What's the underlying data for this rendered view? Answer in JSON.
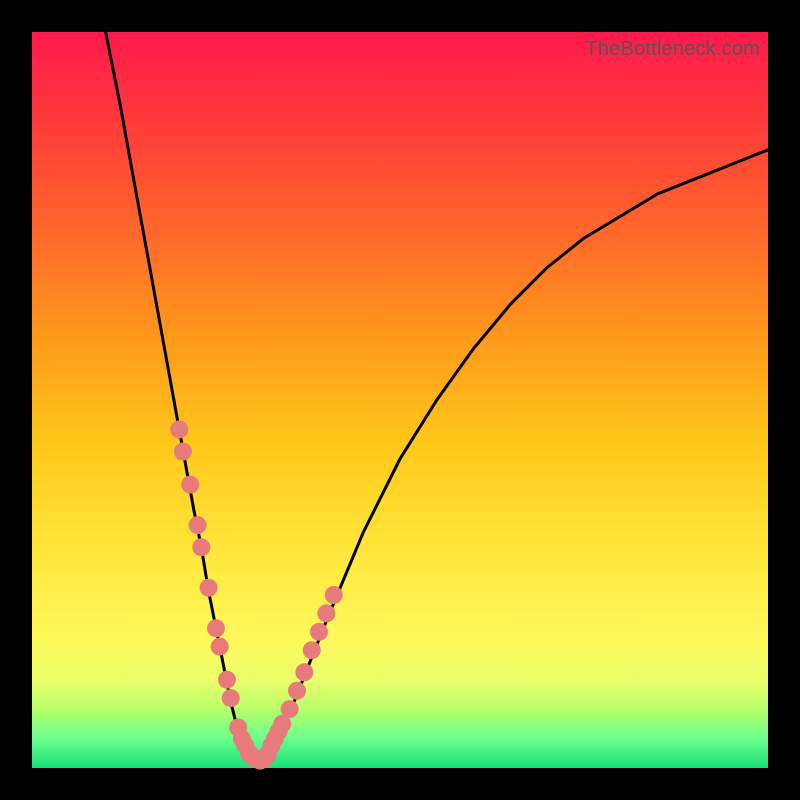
{
  "watermark": "TheBottleneck.com",
  "colors": {
    "curve_stroke": "#000000",
    "dot_fill": "#e77b7b",
    "dot_fill_dark": "#d86a6a",
    "frame": "#000000"
  },
  "chart_data": {
    "type": "line",
    "title": "",
    "xlabel": "",
    "ylabel": "",
    "xlim": [
      0,
      100
    ],
    "ylim": [
      0,
      100
    ],
    "grid": false,
    "legend": false,
    "series": [
      {
        "name": "bottleneck-curve",
        "x": [
          10,
          12,
          14,
          16,
          18,
          20,
          22,
          23,
          24,
          25,
          26,
          27,
          28,
          29,
          30,
          31,
          32,
          34,
          36,
          40,
          45,
          50,
          55,
          60,
          65,
          70,
          75,
          80,
          85,
          90,
          95,
          100
        ],
        "y": [
          100,
          90,
          79,
          68,
          57,
          46,
          35,
          30,
          24,
          19,
          14,
          9,
          5,
          3,
          1,
          1,
          2,
          5,
          10,
          20,
          32,
          42,
          50,
          57,
          63,
          68,
          72,
          75,
          78,
          80,
          82,
          84
        ]
      }
    ],
    "markers": [
      {
        "name": "left-branch-dots",
        "x": [
          20.0,
          20.5,
          21.5,
          22.5,
          23.0,
          24.0,
          25.0,
          25.5,
          26.5,
          27.0,
          28.0,
          28.5,
          29.0,
          29.5,
          30.0
        ],
        "y": [
          46.0,
          43.0,
          38.5,
          33.0,
          30.0,
          24.5,
          19.0,
          16.5,
          12.0,
          9.5,
          5.5,
          4.0,
          3.0,
          2.0,
          1.5
        ]
      },
      {
        "name": "trough-dots",
        "x": [
          30.5,
          31.0,
          31.5,
          32.0
        ],
        "y": [
          1.2,
          1.0,
          1.2,
          1.8
        ]
      },
      {
        "name": "right-branch-dots",
        "x": [
          32.5,
          33.0,
          33.5,
          34.0,
          35.0,
          36.0,
          37.0,
          38.0,
          39.0,
          40.0,
          41.0
        ],
        "y": [
          3.0,
          4.0,
          5.0,
          6.0,
          8.0,
          10.5,
          13.0,
          16.0,
          18.5,
          21.0,
          23.5
        ]
      }
    ]
  }
}
